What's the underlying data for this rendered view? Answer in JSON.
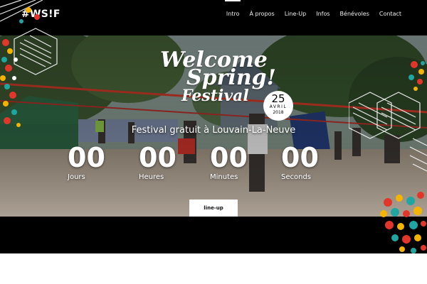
{
  "header": {
    "logo": "#WS!F",
    "nav": [
      "Intro",
      "À propos",
      "Line-Up",
      "Infos",
      "Bénévoles",
      "Contact"
    ],
    "active_nav": "Intro"
  },
  "hero": {
    "logo_line1": "Welcome",
    "logo_line2": "Spring!",
    "logo_line3": "Festival",
    "date_day": "25",
    "date_month": "AVRIL",
    "date_year": "2018",
    "subtitle": "Festival gratuit à Louvain-La-Neuve",
    "countdown": [
      {
        "value": "00",
        "label": "Jours"
      },
      {
        "value": "00",
        "label": "Heures"
      },
      {
        "value": "00",
        "label": "Minutes"
      },
      {
        "value": "00",
        "label": "Seconds"
      }
    ],
    "cta_label": "line-up"
  },
  "colors": {
    "header_bg": "#000000",
    "accent_yellow": "#f4b400",
    "accent_red": "#e2362b",
    "accent_teal": "#1fa6a0"
  }
}
